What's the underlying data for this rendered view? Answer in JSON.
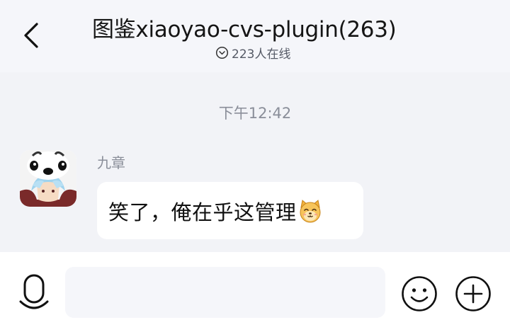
{
  "header": {
    "back_icon": "chevron-left-icon",
    "title": "图鉴xiaoyao-cvs-plugin(263)",
    "online_icon": "chevron-circle-down-icon",
    "online_count": "223人在线"
  },
  "chat": {
    "timestamp": "下午12:42",
    "messages": [
      {
        "sender": "九章",
        "text": "笑了，俺在乎这管理",
        "emoji": "cat-face-emoji"
      }
    ]
  },
  "input_bar": {
    "voice_icon": "microphone-icon",
    "placeholder": "",
    "emoji_icon": "smiley-face-icon",
    "more_icon": "plus-circle-icon"
  },
  "colors": {
    "header_bg": "#f5f6fa",
    "chat_bg": "#f2f3f7",
    "bubble_bg": "#ffffff",
    "meta_text": "#8a8e99"
  }
}
